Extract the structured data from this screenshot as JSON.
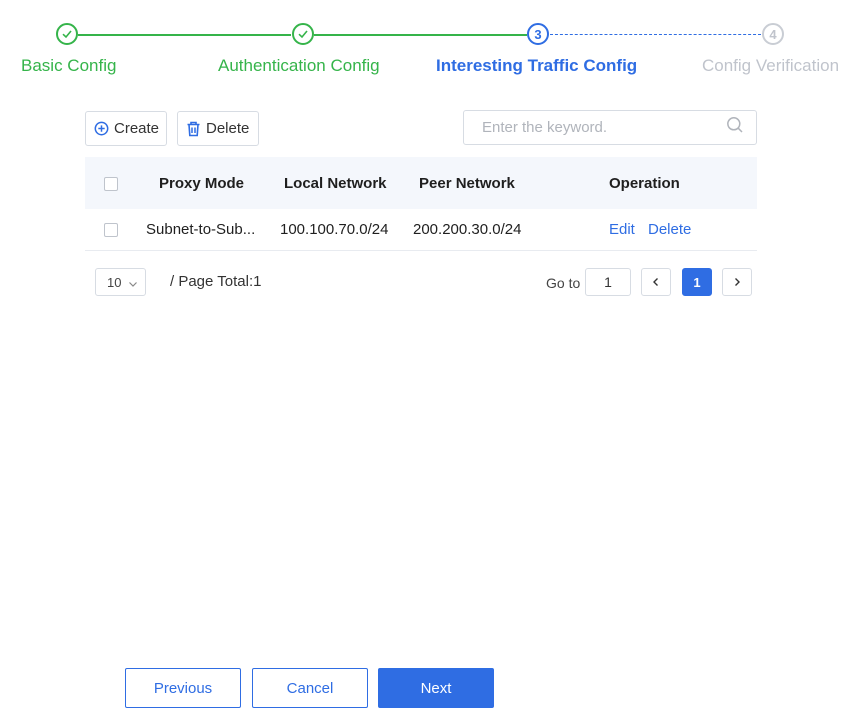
{
  "stepper": {
    "steps": [
      {
        "label": "Basic Config",
        "state": "done"
      },
      {
        "label": "Authentication Config",
        "state": "done"
      },
      {
        "number": "3",
        "label": "Interesting Traffic Config",
        "state": "active"
      },
      {
        "number": "4",
        "label": "Config Verification",
        "state": "todo"
      }
    ]
  },
  "toolbar": {
    "create_label": "Create",
    "delete_label": "Delete",
    "search_placeholder": "Enter the keyword."
  },
  "table": {
    "columns": [
      "Proxy Mode",
      "Local Network",
      "Peer Network",
      "Operation"
    ],
    "rows": [
      {
        "proxy_mode": "Subnet-to-Sub...",
        "local_network": "100.100.70.0/24",
        "peer_network": "200.200.30.0/24",
        "edit": "Edit",
        "delete": "Delete"
      }
    ]
  },
  "pagination": {
    "page_size": "10",
    "total_text": "/ Page Total:1",
    "goto_label": "Go to",
    "goto_value": "1",
    "current_page": "1"
  },
  "footer": {
    "previous": "Previous",
    "cancel": "Cancel",
    "next": "Next"
  },
  "colors": {
    "done": "#35b44a",
    "active": "#2f6de3",
    "todo": "#c0c4cc"
  }
}
